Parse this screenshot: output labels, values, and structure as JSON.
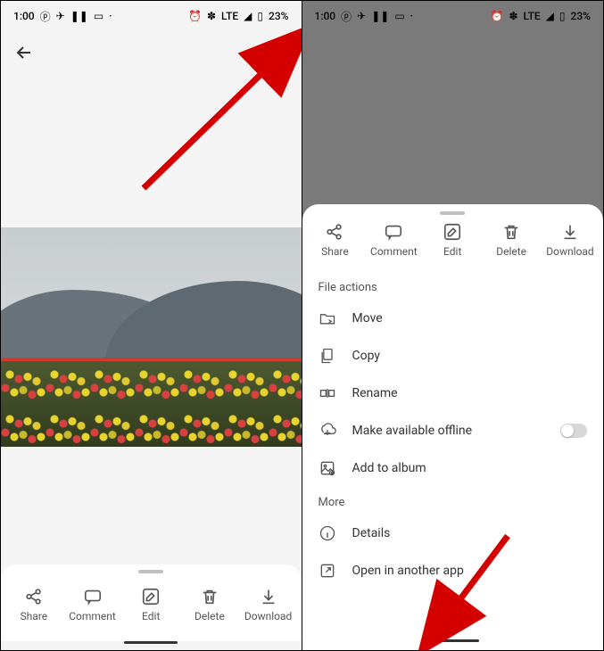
{
  "statusbar": {
    "time": "1:00",
    "network": "LTE",
    "battery": "23%"
  },
  "toolbar": {
    "share": "Share",
    "comment": "Comment",
    "edit": "Edit",
    "delete": "Delete",
    "download": "Download"
  },
  "sheet": {
    "section_file": "File actions",
    "section_more": "More",
    "items": {
      "move": "Move",
      "copy": "Copy",
      "rename": "Rename",
      "offline": "Make available offline",
      "add_album": "Add to album",
      "details": "Details",
      "open_external": "Open in another app"
    }
  }
}
